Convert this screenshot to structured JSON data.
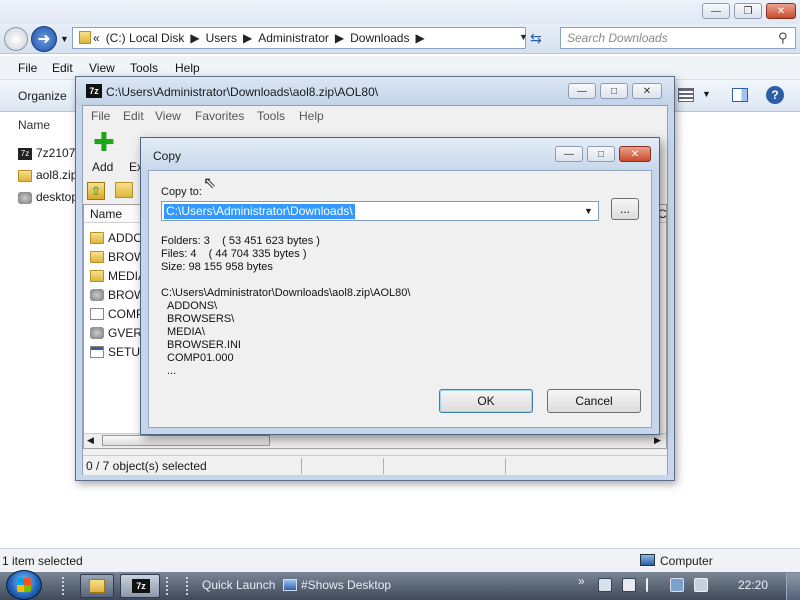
{
  "explorer": {
    "address": {
      "crumbs": [
        "«",
        "(C:) Local Disk",
        "Users",
        "Administrator",
        "Downloads"
      ]
    },
    "search_placeholder": "Search Downloads",
    "menu": [
      "File",
      "Edit",
      "View",
      "Tools",
      "Help"
    ],
    "organize_label": "Organize",
    "name_header": "Name",
    "files": [
      "7z2107...",
      "aol8.zip",
      "desktop..."
    ],
    "status_left": "1 item selected",
    "status_right": "Computer"
  },
  "zip": {
    "title": "C:\\Users\\Administrator\\Downloads\\aol8.zip\\AOL80\\",
    "menu": [
      "File",
      "Edit",
      "View",
      "Favorites",
      "Tools",
      "Help"
    ],
    "toolbar": {
      "add_label": "Add",
      "extract_label": "Ex"
    },
    "list_header": "Name",
    "list_header_right": "C",
    "items": [
      "ADDO",
      "BROW",
      "MEDIA",
      "BROW",
      "COMP",
      "GVERS",
      "SETUP"
    ],
    "status": "0 / 7 object(s) selected"
  },
  "copy_dialog": {
    "title": "Copy",
    "copy_to_label": "Copy to:",
    "path_value": "C:\\Users\\Administrator\\Downloads\\",
    "browse_label": "...",
    "folders": "Folders: 3    ( 53 451 623 bytes )",
    "files": "Files: 4    ( 44 704 335 bytes )",
    "size": "Size: 98 155 958 bytes",
    "source_path": "C:\\Users\\Administrator\\Downloads\\aol8.zip\\AOL80\\",
    "source_items": [
      "ADDONS\\",
      "BROWSERS\\",
      "MEDIA\\",
      "BROWSER.INI",
      "COMP01.000",
      "..."
    ],
    "ok_label": "OK",
    "cancel_label": "Cancel"
  },
  "taskbar": {
    "quick_launch": "Quick Launch",
    "shows_desktop": "#Shows Desktop",
    "clock": "22:20",
    "zip_icon_label": "7z",
    "overflow_arrows": "»"
  }
}
